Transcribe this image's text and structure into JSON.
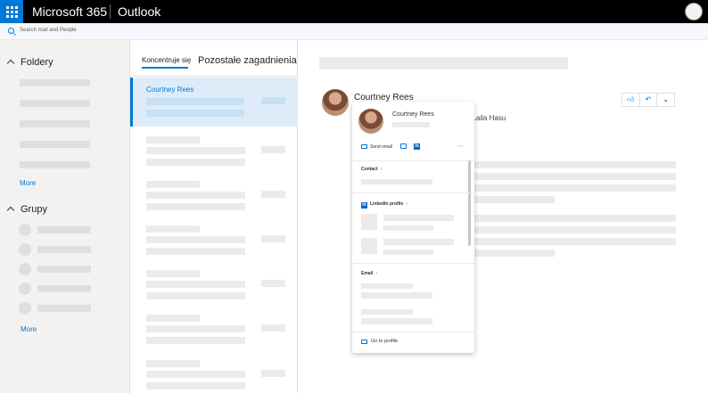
{
  "topbar": {
    "brand": "Microsoft 365",
    "app": "Outlook"
  },
  "search": {
    "placeholder": "Search mail and People"
  },
  "nav": {
    "folders_title": "Foldery",
    "groups_title": "Grupy",
    "more_folders": "More",
    "more_groups": "More"
  },
  "list": {
    "tab_focused": "Koncentruje się",
    "tab_other": "Pozostałe zagadnienia",
    "selected_sender": "Courtney Rees"
  },
  "reading": {
    "sender": "Courtney Rees",
    "recipients_tail": ", Laila Hasu",
    "actions": [
      "like-icon",
      "reply-icon",
      "chevron-down-icon"
    ]
  },
  "card": {
    "name": "Courtney Rees",
    "send_email": "Send email",
    "contact": "Contact",
    "linkedin": "LinkedIn profile",
    "email": "Email",
    "go_to_profile": "Go to profile"
  },
  "colors": {
    "accent": "#0078d4",
    "topbar": "#000000",
    "selected": "#deecf9"
  }
}
